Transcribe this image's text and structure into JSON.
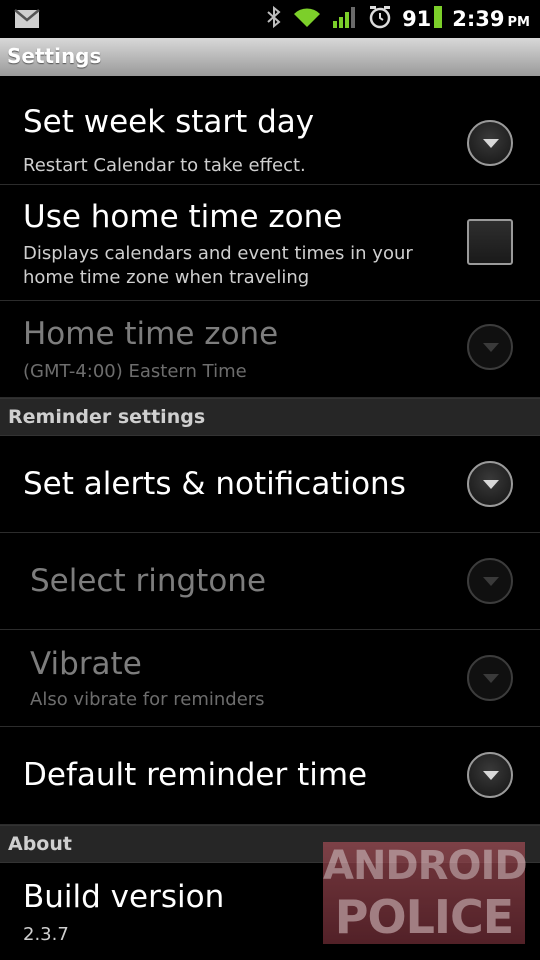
{
  "status_bar": {
    "battery_level": "91",
    "time": "2:39",
    "ampm": "PM"
  },
  "title": "Settings",
  "rows": [
    {
      "title": "Set week start day",
      "subtitle": "Restart Calendar to take effect.",
      "control": "dropdown",
      "enabled": true
    },
    {
      "title": "Use home time zone",
      "subtitle": "Displays calendars and event times in your home time zone when traveling",
      "control": "checkbox",
      "checked": false,
      "enabled": true
    },
    {
      "title": "Home time zone",
      "subtitle": "(GMT-4:00) Eastern Time",
      "control": "dropdown",
      "enabled": false
    }
  ],
  "reminder_section": {
    "header": "Reminder settings",
    "rows": [
      {
        "title": "Set alerts & notifications",
        "control": "dropdown",
        "enabled": true
      },
      {
        "title": "Select ringtone",
        "control": "dropdown",
        "enabled": false
      },
      {
        "title": "Vibrate",
        "subtitle": "Also vibrate for reminders",
        "control": "dropdown",
        "enabled": false
      },
      {
        "title": "Default reminder time",
        "control": "dropdown",
        "enabled": true
      }
    ]
  },
  "about_section": {
    "header": "About",
    "rows": [
      {
        "title": "Build version",
        "subtitle": "2.3.7"
      }
    ]
  },
  "watermark": {
    "line1": "ANDROID",
    "line2": "POLICE"
  },
  "icons": [
    "gmail-notification-icon",
    "bluetooth-icon",
    "wifi-icon",
    "signal-icon",
    "alarm-icon",
    "battery-icon",
    "dropdown-arrow-icon"
  ]
}
